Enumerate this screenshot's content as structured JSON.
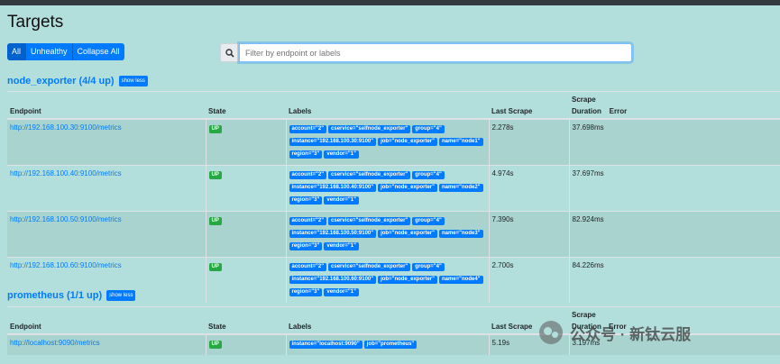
{
  "page": {
    "title": "Targets"
  },
  "filters": {
    "all": "All",
    "unhealthy": "Unhealthy",
    "collapse_all": "Collapse All"
  },
  "search": {
    "placeholder": "Filter by endpoint or labels"
  },
  "columns": {
    "endpoint": "Endpoint",
    "state": "State",
    "labels": "Labels",
    "last_scrape": "Last Scrape",
    "scrape_duration_1": "Scrape",
    "scrape_duration_2": "Duration",
    "error": "Error"
  },
  "jobs": [
    {
      "title": "node_exporter (4/4 up)",
      "toggle": "show less",
      "targets": [
        {
          "endpoint": "http://192.168.100.30:9100/metrics",
          "state": "UP",
          "labels": [
            "account=\"2\"",
            "cservice=\"selfnode_exporter\"",
            "group=\"4\"",
            "instance=\"192.168.100.30:9100\"",
            "job=\"node_exporter\"",
            "name=\"node1\"",
            "region=\"3\"",
            "vendor=\"1\""
          ],
          "last_scrape": "2.278s",
          "duration": "37.698ms",
          "error": ""
        },
        {
          "endpoint": "http://192.168.100.40:9100/metrics",
          "state": "UP",
          "labels": [
            "account=\"2\"",
            "cservice=\"selfnode_exporter\"",
            "group=\"4\"",
            "instance=\"192.168.100.40:9100\"",
            "job=\"node_exporter\"",
            "name=\"node2\"",
            "region=\"3\"",
            "vendor=\"1\""
          ],
          "last_scrape": "4.974s",
          "duration": "37.697ms",
          "error": ""
        },
        {
          "endpoint": "http://192.168.100.50:9100/metrics",
          "state": "UP",
          "labels": [
            "account=\"2\"",
            "cservice=\"selfnode_exporter\"",
            "group=\"4\"",
            "instance=\"192.168.100.50:9100\"",
            "job=\"node_exporter\"",
            "name=\"node3\"",
            "region=\"3\"",
            "vendor=\"1\""
          ],
          "last_scrape": "7.390s",
          "duration": "82.924ms",
          "error": ""
        },
        {
          "endpoint": "http://192.168.100.60:9100/metrics",
          "state": "UP",
          "labels": [
            "account=\"2\"",
            "cservice=\"selfnode_exporter\"",
            "group=\"4\"",
            "instance=\"192.168.100.60:9100\"",
            "job=\"node_exporter\"",
            "name=\"node4\"",
            "region=\"3\"",
            "vendor=\"1\""
          ],
          "last_scrape": "2.700s",
          "duration": "84.226ms",
          "error": ""
        }
      ]
    },
    {
      "title": "prometheus (1/1 up)",
      "toggle": "show less",
      "targets": [
        {
          "endpoint": "http://localhost:9090/metrics",
          "state": "UP",
          "labels": [
            "instance=\"localhost:9090\"",
            "job=\"prometheus\""
          ],
          "last_scrape": "5.19s",
          "duration": "3.197ms",
          "error": ""
        }
      ]
    }
  ],
  "watermark": {
    "text": "公众号 · 新钛云服"
  },
  "colors": {
    "primary": "#007bff",
    "success": "#28a745",
    "background": "#b2dfdb"
  },
  "icons": {
    "search": "search-icon",
    "watermark": "wechat-icon"
  }
}
